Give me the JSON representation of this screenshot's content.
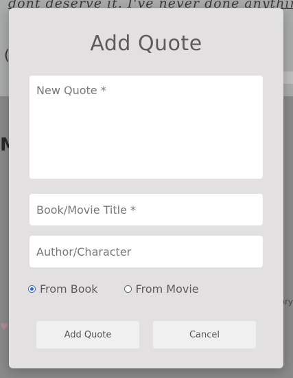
{
  "background": {
    "script_text": "dont deserve it. I've never done anything for",
    "partial_letter": "(",
    "heading_fragment": "My",
    "story_fragment": "ory",
    "heart_icon": "heart-icon"
  },
  "modal": {
    "title": "Add Quote",
    "quote_placeholder": "New Quote *",
    "title_placeholder": "Book/Movie Title *",
    "author_placeholder": "Author/Character",
    "source_options": [
      {
        "label": "From Book",
        "checked": true
      },
      {
        "label": "From Movie",
        "checked": false
      }
    ],
    "submit_label": "Add Quote",
    "cancel_label": "Cancel"
  },
  "colors": {
    "overlay": "#8e8e8e",
    "modal_bg": "#e2e0e0",
    "title_color": "#5f5b5b",
    "radio_accent": "#2f66df"
  }
}
